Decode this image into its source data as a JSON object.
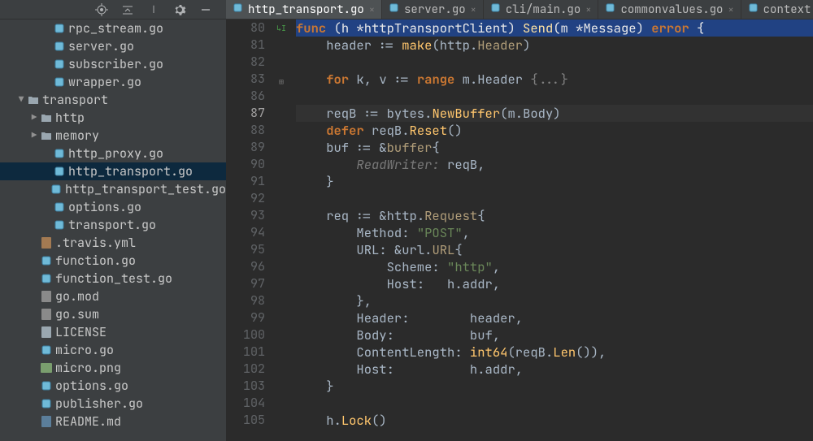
{
  "toolbar": {
    "target_icon": "target-icon",
    "collapse_icon": "collapse-all-icon",
    "settings_icon": "gear-icon",
    "hide_icon": "hide-icon"
  },
  "sidebar": {
    "items": [
      {
        "indent": 3,
        "icon": "go",
        "label": "rpc_stream.go"
      },
      {
        "indent": 3,
        "icon": "go",
        "label": "server.go"
      },
      {
        "indent": 3,
        "icon": "go",
        "label": "subscriber.go"
      },
      {
        "indent": 3,
        "icon": "go",
        "label": "wrapper.go"
      },
      {
        "indent": 1,
        "icon": "folder",
        "label": "transport",
        "arrow": "down"
      },
      {
        "indent": 2,
        "icon": "folder",
        "label": "http",
        "arrow": "right"
      },
      {
        "indent": 2,
        "icon": "folder",
        "label": "memory",
        "arrow": "right"
      },
      {
        "indent": 3,
        "icon": "go",
        "label": "http_proxy.go"
      },
      {
        "indent": 3,
        "icon": "go",
        "label": "http_transport.go",
        "selected": true
      },
      {
        "indent": 3,
        "icon": "go",
        "label": "http_transport_test.go"
      },
      {
        "indent": 3,
        "icon": "go",
        "label": "options.go"
      },
      {
        "indent": 3,
        "icon": "go",
        "label": "transport.go"
      },
      {
        "indent": 2,
        "icon": "yml",
        "label": ".travis.yml"
      },
      {
        "indent": 2,
        "icon": "go",
        "label": "function.go"
      },
      {
        "indent": 2,
        "icon": "go",
        "label": "function_test.go"
      },
      {
        "indent": 2,
        "icon": "mod",
        "label": "go.mod"
      },
      {
        "indent": 2,
        "icon": "mod",
        "label": "go.sum"
      },
      {
        "indent": 2,
        "icon": "txt",
        "label": "LICENSE"
      },
      {
        "indent": 2,
        "icon": "go",
        "label": "micro.go"
      },
      {
        "indent": 2,
        "icon": "img",
        "label": "micro.png"
      },
      {
        "indent": 2,
        "icon": "go",
        "label": "options.go"
      },
      {
        "indent": 2,
        "icon": "go",
        "label": "publisher.go"
      },
      {
        "indent": 2,
        "icon": "md",
        "label": "README.md"
      }
    ]
  },
  "tabs": [
    {
      "label": "http_transport.go",
      "active": true
    },
    {
      "label": "server.go"
    },
    {
      "label": "cli/main.go"
    },
    {
      "label": "commonvalues.go"
    },
    {
      "label": "context.go"
    }
  ],
  "editor": {
    "first_line_no": 80,
    "active_line_no": 87,
    "lines": [
      {
        "n": 80,
        "sel": true,
        "tokens": [
          [
            "kw",
            "func "
          ],
          [
            "par",
            "(h "
          ],
          [
            "op",
            "*"
          ],
          [
            "cls",
            "httpTransportClient"
          ],
          [
            "par",
            ") "
          ],
          [
            "fn",
            "Send"
          ],
          [
            "par",
            "(m "
          ],
          [
            "op",
            "*"
          ],
          [
            "cls",
            "Message"
          ],
          [
            "par",
            ") "
          ],
          [
            "kw",
            "error "
          ],
          [
            "par",
            "{"
          ]
        ]
      },
      {
        "n": 81,
        "tokens": [
          [
            "op",
            "    header "
          ],
          [
            "op",
            ":= "
          ],
          [
            "fn",
            "make"
          ],
          [
            "par",
            "("
          ],
          [
            "typ",
            "http"
          ],
          [
            "op",
            "."
          ],
          [
            "cls",
            "Header"
          ],
          [
            "par",
            ")"
          ]
        ]
      },
      {
        "n": 82,
        "tokens": []
      },
      {
        "n": 83,
        "fold": "plus",
        "tokens": [
          [
            "op",
            "    "
          ],
          [
            "kw",
            "for "
          ],
          [
            "typ",
            "k"
          ],
          [
            "op",
            ", "
          ],
          [
            "typ",
            "v"
          ],
          [
            "op",
            " := "
          ],
          [
            "kw",
            "range "
          ],
          [
            "typ",
            "m"
          ],
          [
            "op",
            "."
          ],
          [
            "typ",
            "Header "
          ],
          [
            "cm",
            "{...}"
          ]
        ]
      },
      {
        "n": 86,
        "tokens": []
      },
      {
        "n": 87,
        "caret": true,
        "tokens": [
          [
            "op",
            "    reqB "
          ],
          [
            "op",
            ":= "
          ],
          [
            "typ",
            "bytes"
          ],
          [
            "op",
            "."
          ],
          [
            "fn",
            "NewBuffer"
          ],
          [
            "par",
            "("
          ],
          [
            "typ",
            "m"
          ],
          [
            "op",
            "."
          ],
          [
            "typ",
            "Body"
          ],
          [
            "par",
            ")"
          ]
        ]
      },
      {
        "n": 88,
        "tokens": [
          [
            "op",
            "    "
          ],
          [
            "kw",
            "defer "
          ],
          [
            "typ",
            "reqB"
          ],
          [
            "op",
            "."
          ],
          [
            "fn",
            "Reset"
          ],
          [
            "par",
            "()"
          ]
        ]
      },
      {
        "n": 89,
        "tokens": [
          [
            "op",
            "    buf "
          ],
          [
            "op",
            ":= &"
          ],
          [
            "cls",
            "buffer"
          ],
          [
            "par",
            "{"
          ]
        ]
      },
      {
        "n": 90,
        "tokens": [
          [
            "op",
            "        "
          ],
          [
            "hint",
            "ReadWriter: "
          ],
          [
            "typ",
            "reqB"
          ],
          [
            "op",
            ","
          ]
        ]
      },
      {
        "n": 91,
        "tokens": [
          [
            "op",
            "    "
          ],
          [
            "par",
            "}"
          ]
        ]
      },
      {
        "n": 92,
        "tokens": []
      },
      {
        "n": 93,
        "tokens": [
          [
            "op",
            "    req "
          ],
          [
            "op",
            ":= &"
          ],
          [
            "typ",
            "http"
          ],
          [
            "op",
            "."
          ],
          [
            "cls",
            "Request"
          ],
          [
            "par",
            "{"
          ]
        ]
      },
      {
        "n": 94,
        "tokens": [
          [
            "op",
            "        "
          ],
          [
            "typ",
            "Method"
          ],
          [
            "op",
            ": "
          ],
          [
            "str",
            "\"POST\""
          ],
          [
            "op",
            ","
          ]
        ]
      },
      {
        "n": 95,
        "tokens": [
          [
            "op",
            "        "
          ],
          [
            "typ",
            "URL"
          ],
          [
            "op",
            ": &"
          ],
          [
            "typ",
            "url"
          ],
          [
            "op",
            "."
          ],
          [
            "cls",
            "URL"
          ],
          [
            "par",
            "{"
          ]
        ]
      },
      {
        "n": 96,
        "tokens": [
          [
            "op",
            "            "
          ],
          [
            "typ",
            "Scheme"
          ],
          [
            "op",
            ": "
          ],
          [
            "str",
            "\"http\""
          ],
          [
            "op",
            ","
          ]
        ]
      },
      {
        "n": 97,
        "tokens": [
          [
            "op",
            "            "
          ],
          [
            "typ",
            "Host"
          ],
          [
            "op",
            ":   "
          ],
          [
            "typ",
            "h"
          ],
          [
            "op",
            "."
          ],
          [
            "typ",
            "addr"
          ],
          [
            "op",
            ","
          ]
        ]
      },
      {
        "n": 98,
        "tokens": [
          [
            "op",
            "        "
          ],
          [
            "par",
            "}"
          ],
          [
            "op",
            ","
          ]
        ]
      },
      {
        "n": 99,
        "tokens": [
          [
            "op",
            "        "
          ],
          [
            "typ",
            "Header"
          ],
          [
            "op",
            ":        "
          ],
          [
            "typ",
            "header"
          ],
          [
            "op",
            ","
          ]
        ]
      },
      {
        "n": 100,
        "tokens": [
          [
            "op",
            "        "
          ],
          [
            "typ",
            "Body"
          ],
          [
            "op",
            ":          "
          ],
          [
            "typ",
            "buf"
          ],
          [
            "op",
            ","
          ]
        ]
      },
      {
        "n": 101,
        "tokens": [
          [
            "op",
            "        "
          ],
          [
            "typ",
            "ContentLength"
          ],
          [
            "op",
            ": "
          ],
          [
            "fn",
            "int64"
          ],
          [
            "par",
            "("
          ],
          [
            "typ",
            "reqB"
          ],
          [
            "op",
            "."
          ],
          [
            "fn",
            "Len"
          ],
          [
            "par",
            "())"
          ],
          [
            "op",
            ","
          ]
        ]
      },
      {
        "n": 102,
        "tokens": [
          [
            "op",
            "        "
          ],
          [
            "typ",
            "Host"
          ],
          [
            "op",
            ":          "
          ],
          [
            "typ",
            "h"
          ],
          [
            "op",
            "."
          ],
          [
            "typ",
            "addr"
          ],
          [
            "op",
            ","
          ]
        ]
      },
      {
        "n": 103,
        "tokens": [
          [
            "op",
            "    "
          ],
          [
            "par",
            "}"
          ]
        ]
      },
      {
        "n": 104,
        "tokens": []
      },
      {
        "n": 105,
        "tokens": [
          [
            "op",
            "    "
          ],
          [
            "typ",
            "h"
          ],
          [
            "op",
            "."
          ],
          [
            "fn",
            "Lock"
          ],
          [
            "par",
            "()"
          ]
        ]
      }
    ]
  }
}
